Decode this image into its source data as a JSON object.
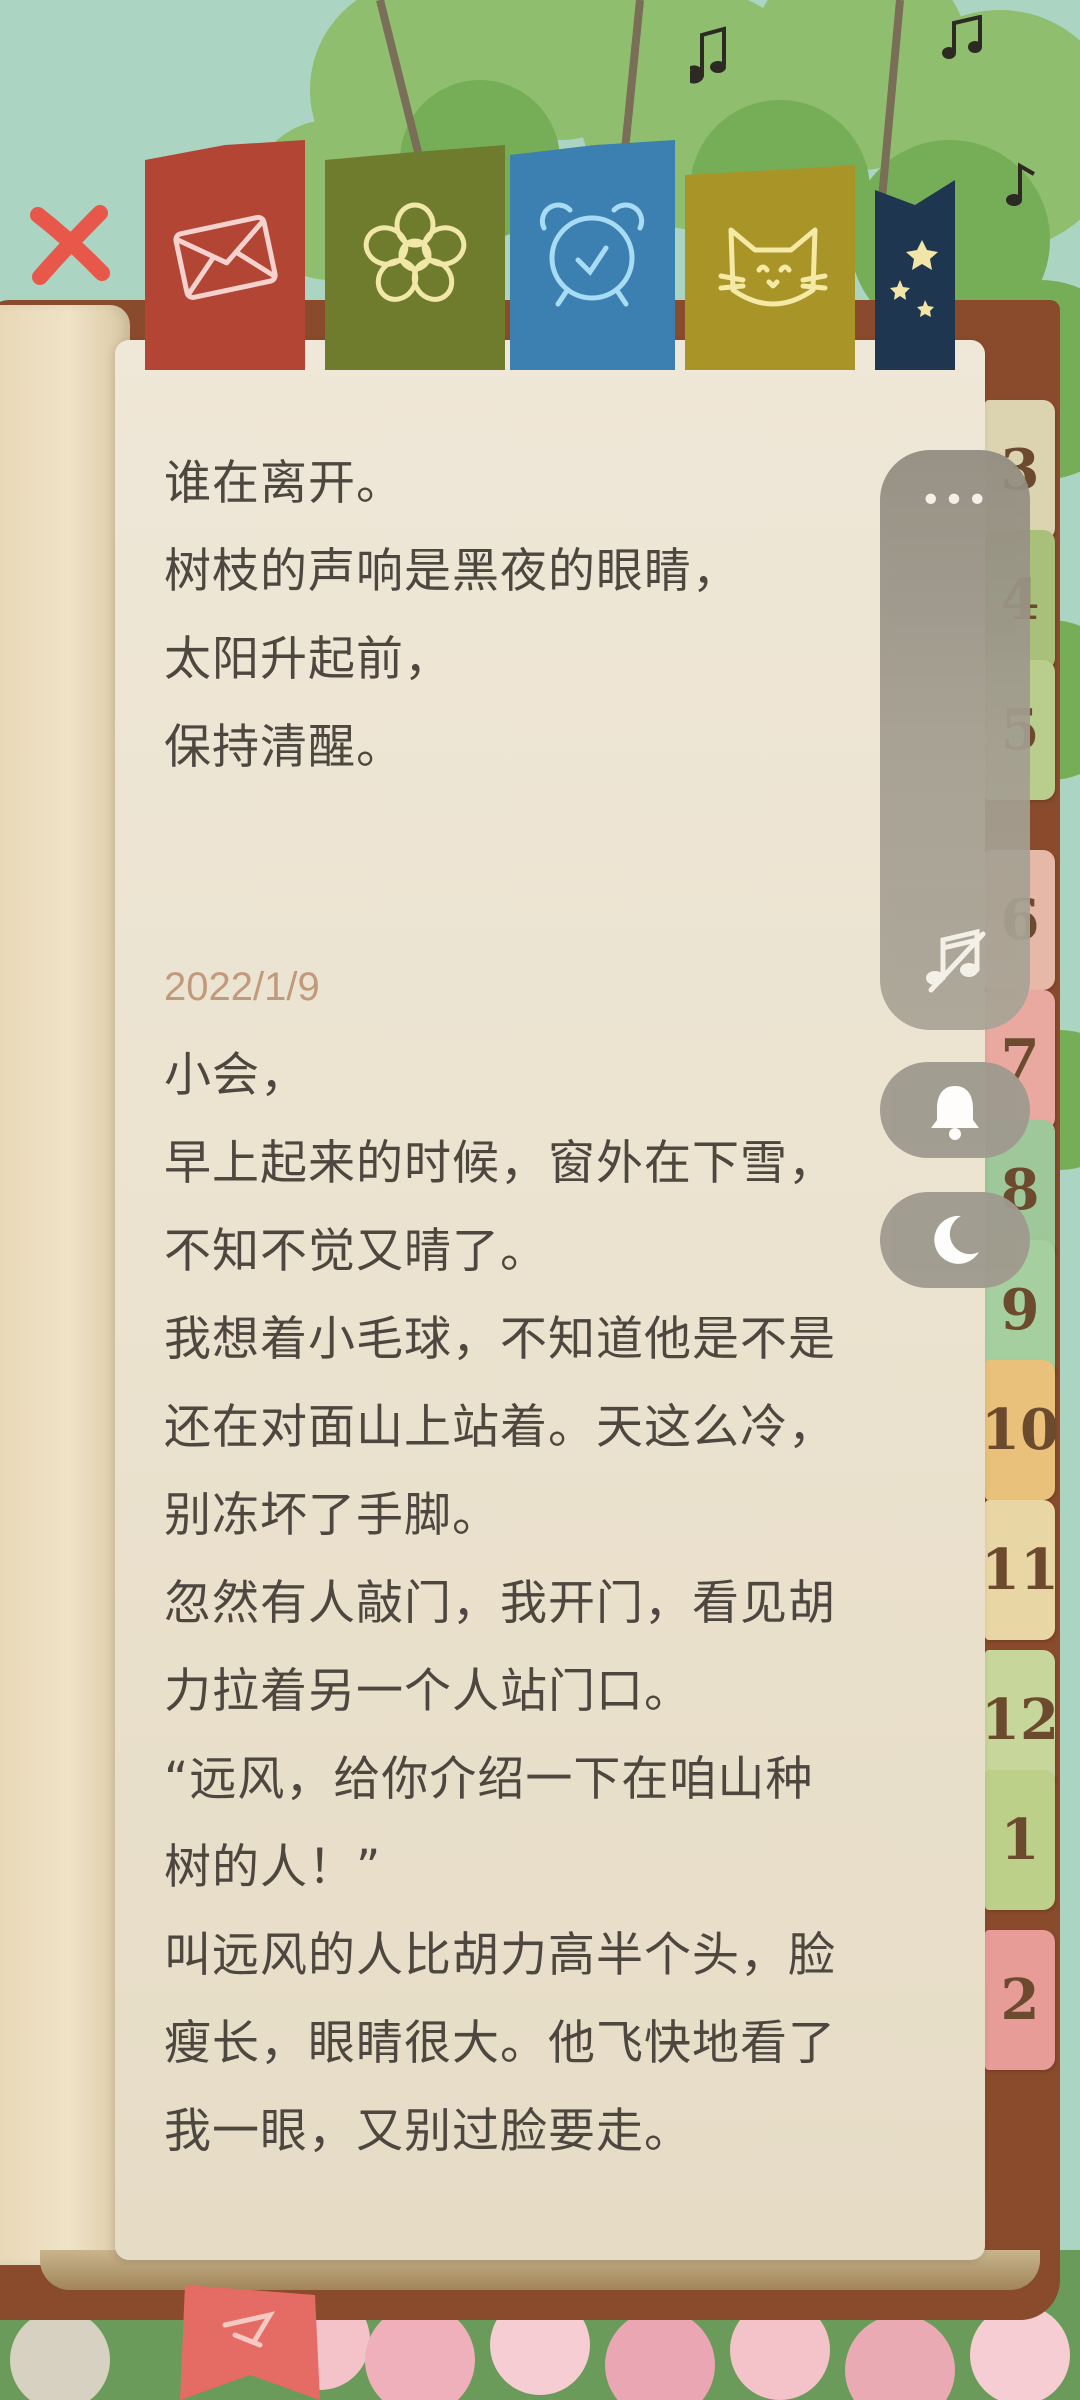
{
  "header": {
    "tabs": [
      {
        "name": "close",
        "icon": "close-icon",
        "color": "#e85a45"
      },
      {
        "name": "letter",
        "icon": "letter-icon",
        "color": "#b04534"
      },
      {
        "name": "flower",
        "icon": "flower-icon",
        "color": "#6e7a2c"
      },
      {
        "name": "alarm",
        "icon": "alarm-clock-icon",
        "color": "#3a7fb0"
      },
      {
        "name": "cat",
        "icon": "cat-icon",
        "color": "#a89427"
      },
      {
        "name": "stars",
        "icon": "stars-icon",
        "color": "#1f3550"
      }
    ]
  },
  "diary": {
    "lines_before": [
      "谁在离开。",
      "树枝的声响是黑夜的眼睛，",
      "太阳升起前，",
      "保持清醒。"
    ],
    "entry_date": "2022/1/9",
    "lines_after": [
      "小会，",
      "早上起来的时候，窗外在下雪，",
      "不知不觉又晴了。",
      "我想着小毛球，不知道他是不是",
      "还在对面山上站着。天这么冷，",
      "别冻坏了手脚。",
      "忽然有人敲门，我开门，看见胡",
      "力拉着另一个人站门口。",
      "“远风，给你介绍一下在咱山种",
      "树的人！”",
      "叫远风的人比胡力高半个头，脸",
      "瘦长，眼睛很大。他飞快地看了",
      "我一眼，又别过脸要走。"
    ]
  },
  "month_tabs": [
    {
      "label": "3",
      "color": "#dcd3b0"
    },
    {
      "label": "4",
      "color": "#a8c07a"
    },
    {
      "label": "5",
      "color": "#b9cd8d"
    },
    {
      "label": "6",
      "color": "#e6b8a8"
    },
    {
      "label": "7",
      "color": "#e9a8a0"
    },
    {
      "label": "8",
      "color": "#9ec89a"
    },
    {
      "label": "9",
      "color": "#a6cfa0"
    },
    {
      "label": "10",
      "color": "#e9c17a"
    },
    {
      "label": "11",
      "color": "#e8d7a4"
    },
    {
      "label": "12",
      "color": "#c7d69a"
    },
    {
      "label": "1",
      "color": "#bcd08a"
    },
    {
      "label": "2",
      "color": "#e79c98"
    }
  ],
  "controls": {
    "more_label": "•••",
    "music_icon": "music-off-icon",
    "bell_icon": "bell-icon",
    "moon_icon": "moon-icon"
  }
}
